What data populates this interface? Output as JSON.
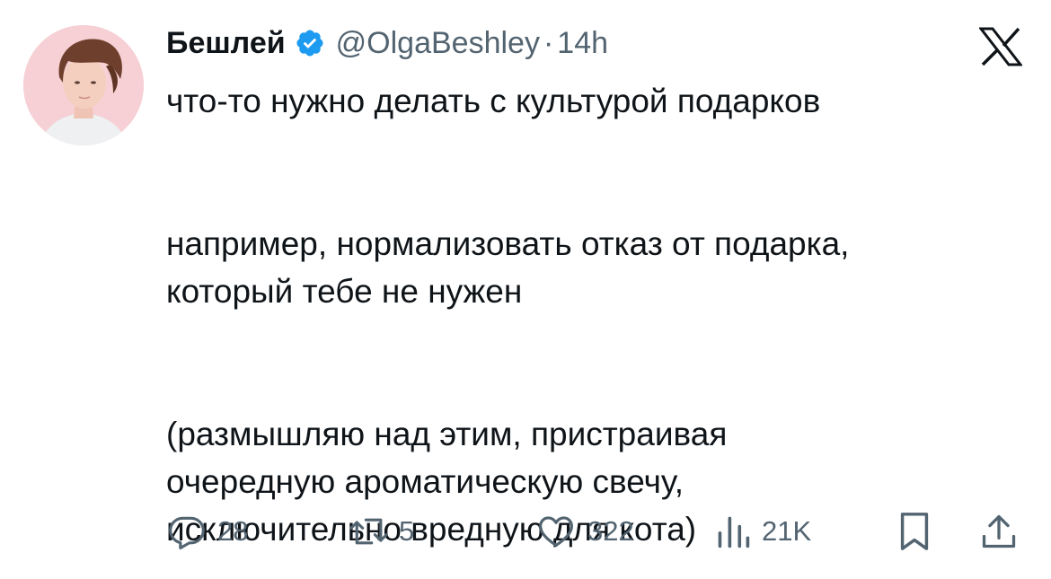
{
  "tweet": {
    "author": {
      "display_name": "Бешлей",
      "handle": "@OlgaBeshley",
      "separator": "·",
      "timestamp": "14h",
      "verified": true,
      "verified_color": "#1d9bf0"
    },
    "text": {
      "paragraph_1_line_1": "что-то нужно делать с культурой подарков",
      "paragraph_2_line_1": "например, нормализовать отказ от подарка,",
      "paragraph_2_line_2": "который тебе не нужен",
      "paragraph_3_line_1": "(размышляю над этим, пристраивая",
      "paragraph_3_line_2": "очередную ароматическую свечу,",
      "paragraph_3_line_3": "исключительно вредную для кота)"
    },
    "actions": {
      "replies": "28",
      "reposts": "5",
      "likes": "322",
      "views": "21K"
    }
  },
  "icons": {
    "platform": "x-logo-icon",
    "reply": "reply-icon",
    "repost": "repost-icon",
    "like": "heart-icon",
    "views": "views-icon",
    "bookmark": "bookmark-icon",
    "share": "share-icon"
  },
  "colors": {
    "text": "#0f1419",
    "secondary": "#536471",
    "avatar_bg": "#f6d0d4"
  }
}
